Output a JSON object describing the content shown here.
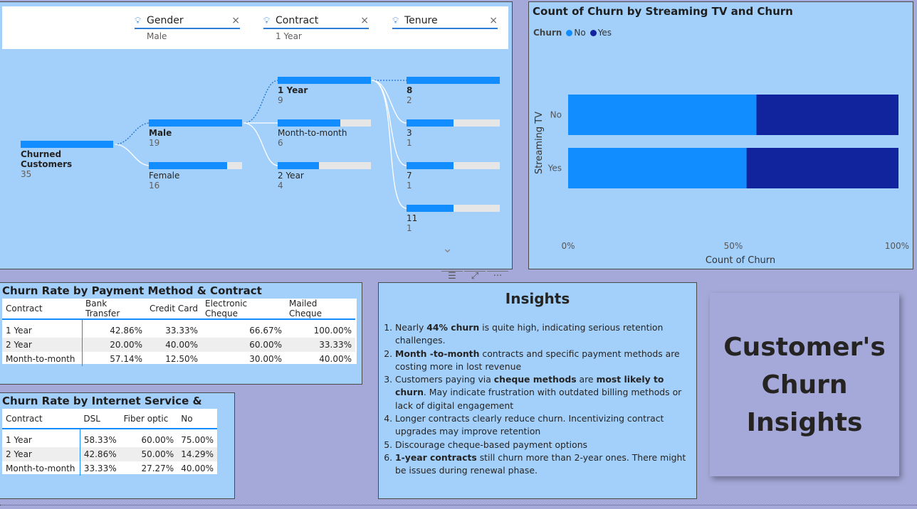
{
  "decomposition": {
    "filters": [
      {
        "name": "Gender",
        "value": "Male"
      },
      {
        "name": "Contract",
        "value": "1 Year"
      },
      {
        "name": "Tenure",
        "value": ""
      }
    ],
    "root": {
      "label": "Churned Customers",
      "value": "35",
      "fill": 1.0
    },
    "level1": [
      {
        "label": "Male",
        "value": "19",
        "fill": 1.0,
        "selected": true
      },
      {
        "label": "Female",
        "value": "16",
        "fill": 0.84,
        "selected": false
      }
    ],
    "level2": [
      {
        "label": "1 Year",
        "value": "9",
        "fill": 1.0,
        "selected": true
      },
      {
        "label": "Month-to-month",
        "value": "6",
        "fill": 0.67,
        "selected": false
      },
      {
        "label": "2 Year",
        "value": "4",
        "fill": 0.44,
        "selected": false
      }
    ],
    "level3": [
      {
        "label": "8",
        "value": "2",
        "fill": 1.0,
        "selected": true
      },
      {
        "label": "3",
        "value": "1",
        "fill": 0.5,
        "selected": false
      },
      {
        "label": "7",
        "value": "1",
        "fill": 0.5,
        "selected": false
      },
      {
        "label": "11",
        "value": "1",
        "fill": 0.5,
        "selected": false
      }
    ],
    "chevron": "⌄"
  },
  "toolbar": {
    "filter_icon": "☰",
    "focus_icon": "⤢",
    "more_icon": "···"
  },
  "chart_data": {
    "type": "bar",
    "orientation": "horizontal",
    "stacked_percent": true,
    "title": "Count of Churn by Streaming TV and Churn",
    "legend_title": "Churn",
    "categories": [
      "No",
      "Yes"
    ],
    "series": [
      {
        "name": "No",
        "color": "#118dff",
        "values": [
          0.57,
          0.54
        ]
      },
      {
        "name": "Yes",
        "color": "#12239e",
        "values": [
          0.43,
          0.46
        ]
      }
    ],
    "xlabel": "Count of Churn",
    "ylabel": "Streaming TV",
    "xticks": [
      "0%",
      "50%",
      "100%"
    ],
    "xlim": [
      0,
      1
    ],
    "legend_position": "top-left"
  },
  "payment_table": {
    "title": "Churn Rate by Payment Method & Contract",
    "headers": [
      "Contract",
      "Bank Transfer",
      "Credit Card",
      "Electronic Cheque",
      "Mailed Cheque"
    ],
    "rows": [
      [
        "1 Year",
        "42.86%",
        "33.33%",
        "66.67%",
        "100.00%"
      ],
      [
        "2 Year",
        "20.00%",
        "40.00%",
        "60.00%",
        "33.33%"
      ],
      [
        "Month-to-month",
        "57.14%",
        "12.50%",
        "30.00%",
        "40.00%"
      ]
    ]
  },
  "internet_table": {
    "title": "Churn Rate by Internet Service & Contract",
    "headers": [
      "Contract",
      "DSL",
      "Fiber optic",
      "No"
    ],
    "rows": [
      [
        "1 Year",
        "58.33%",
        "60.00%",
        "75.00%"
      ],
      [
        "2 Year",
        "42.86%",
        "50.00%",
        "14.29%"
      ],
      [
        "Month-to-month",
        "33.33%",
        "27.27%",
        "40.00%"
      ]
    ]
  },
  "insights": {
    "title": "Insights",
    "items": [
      [
        {
          "t": "Nearly "
        },
        {
          "t": "44% churn",
          "b": true
        },
        {
          "t": " is quite high, indicating serious retention challenges."
        }
      ],
      [
        {
          "t": "Month -to-month",
          "b": true
        },
        {
          "t": " contracts and specific payment methods are costing more in lost revenue"
        }
      ],
      [
        {
          "t": "Customers paying via "
        },
        {
          "t": "cheque methods",
          "b": true
        },
        {
          "t": " are "
        },
        {
          "t": "most likely to churn",
          "b": true
        },
        {
          "t": ". May indicate frustration with outdated billing methods or lack of digital engagement"
        }
      ],
      [
        {
          "t": "Longer contracts clearly reduce churn. Incentivizing contract upgrades may improve retention"
        }
      ],
      [
        {
          "t": "Discourage cheque-based payment options"
        }
      ],
      [
        {
          "t": "1-year contracts",
          "b": true
        },
        {
          "t": " still churn more than 2-year ones. There might be issues during renewal phase."
        }
      ]
    ]
  },
  "title_card": {
    "text": "Customer's\nChurn\nInsights"
  }
}
